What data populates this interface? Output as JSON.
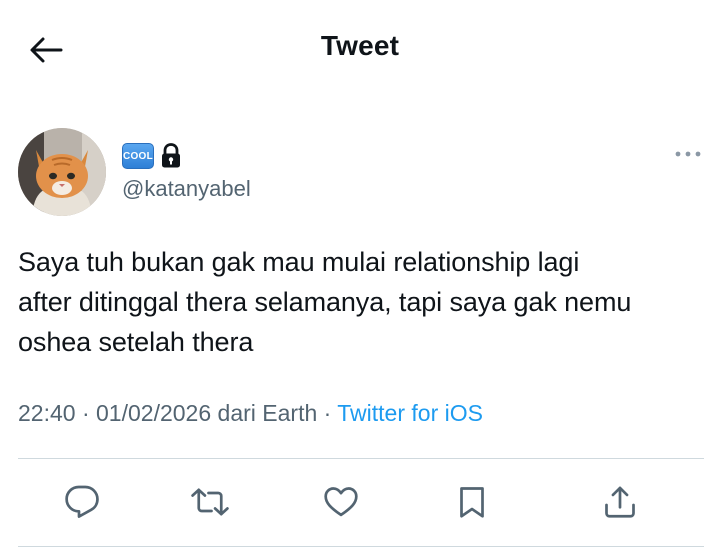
{
  "header": {
    "title": "Tweet",
    "back_icon": "arrow-left-icon"
  },
  "author": {
    "avatar": "cat-avatar",
    "badge_label": "COOL",
    "lock_icon": "lock-icon",
    "handle": "@katanyabel",
    "more_icon": "more-horizontal-icon"
  },
  "tweet": {
    "text": "Saya tuh bukan gak mau mulai relationship lagi\nafter ditinggal thera selamanya, tapi saya gak nemu\noshea setelah thera",
    "time": "22:40",
    "separator": " · ",
    "date": "01/02/2026",
    "location": " dari Earth",
    "source": "Twitter for iOS"
  },
  "actions": [
    {
      "name": "reply",
      "icon": "reply-icon"
    },
    {
      "name": "retweet",
      "icon": "retweet-icon"
    },
    {
      "name": "like",
      "icon": "heart-icon"
    },
    {
      "name": "bookmark",
      "icon": "bookmark-icon"
    },
    {
      "name": "share",
      "icon": "share-icon"
    }
  ],
  "colors": {
    "text": "#0f1419",
    "secondary": "#536471",
    "accent": "#1d9bf0",
    "divider": "#cfd9de",
    "badge": "#2e7fd6"
  }
}
